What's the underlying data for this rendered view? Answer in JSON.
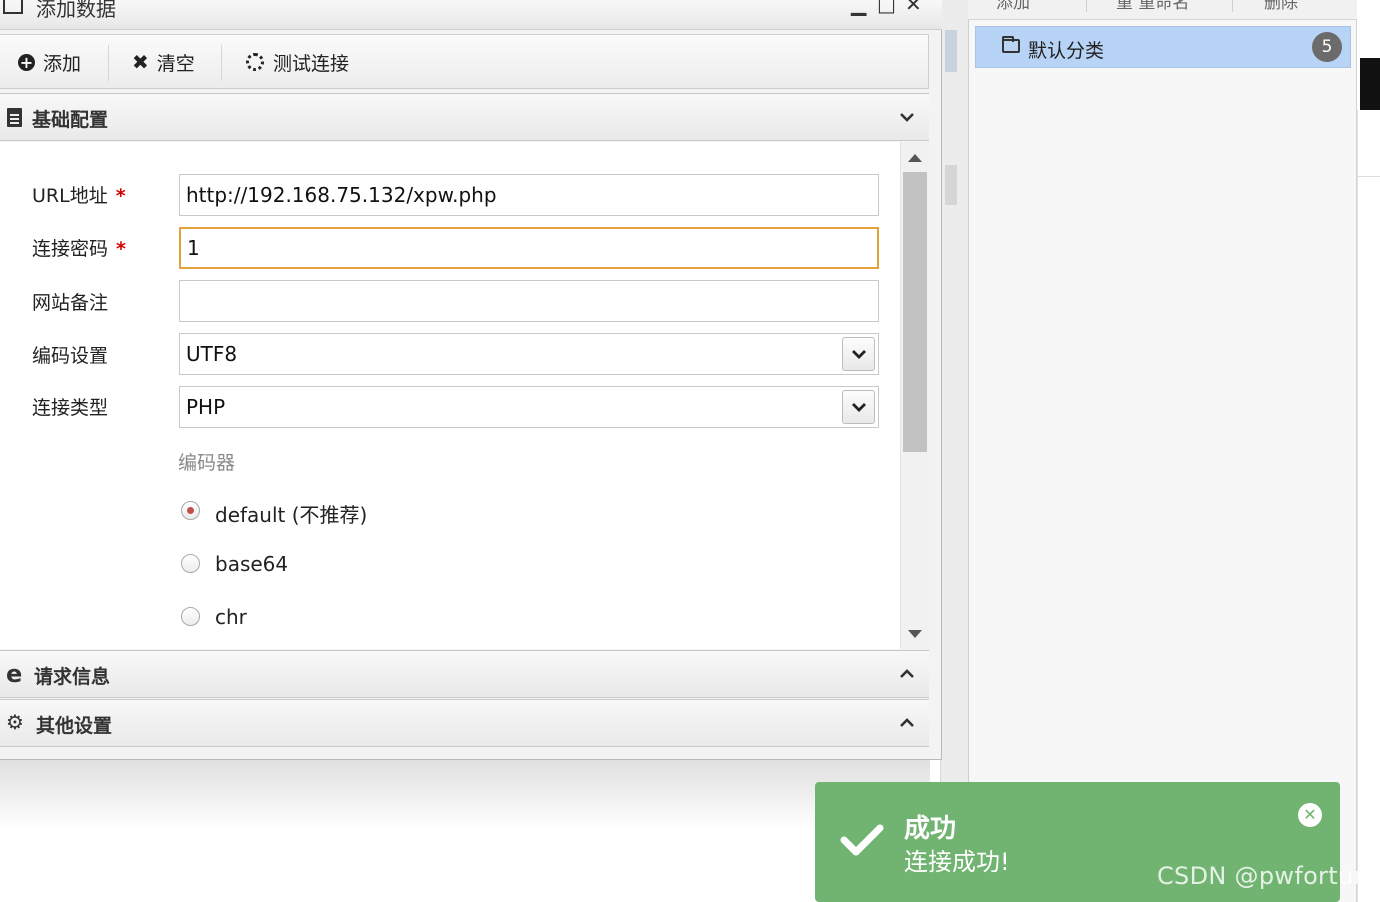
{
  "dialog": {
    "title": "添加数据",
    "window_buttons": [
      "▁",
      "□",
      "✕"
    ]
  },
  "toolbar": {
    "add_label": "添加",
    "clear_label": "清空",
    "test_label": "测试连接"
  },
  "sections": {
    "basic": "基础配置",
    "request": "请求信息",
    "other": "其他设置"
  },
  "form": {
    "url": {
      "label": "URL地址",
      "required": "*",
      "value": "http://192.168.75.132/xpw.php"
    },
    "password": {
      "label": "连接密码",
      "required": "*",
      "value": "1"
    },
    "note": {
      "label": "网站备注",
      "value": ""
    },
    "encoding": {
      "label": "编码设置",
      "value": "UTF8"
    },
    "conn_type": {
      "label": "连接类型",
      "value": "PHP"
    },
    "encoder": {
      "label": "编码器",
      "options": [
        "default (不推荐)",
        "base64",
        "chr"
      ],
      "selected": "default (不推荐)"
    }
  },
  "right_panel": {
    "toolbar_items": [
      "添加",
      "重 重命名",
      "删除"
    ],
    "category": {
      "label": "默认分类",
      "count": "5"
    }
  },
  "toast": {
    "title": "成功",
    "message": "连接成功!",
    "color": "#71b371"
  },
  "watermark": "CSDN @pwfortune"
}
